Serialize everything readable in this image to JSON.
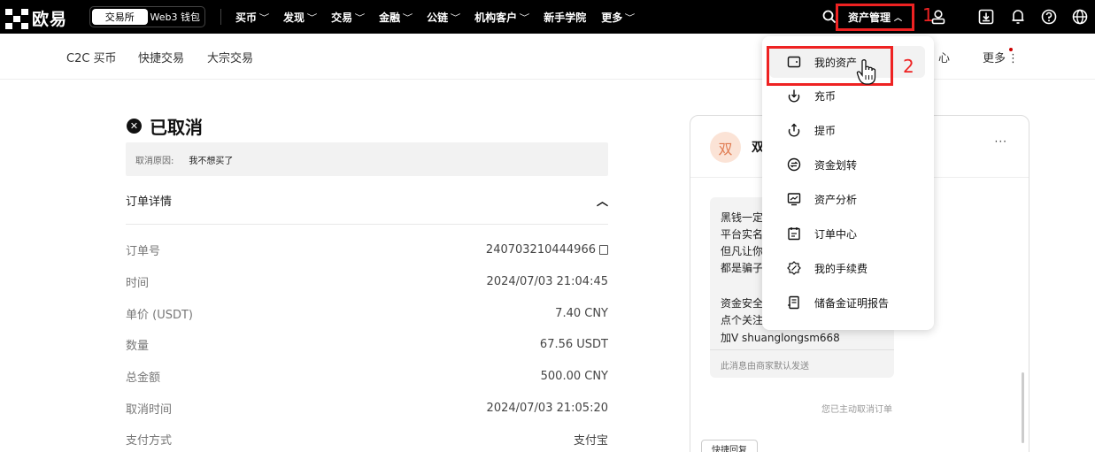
{
  "topnav": {
    "logo_text": "欧易",
    "switch": [
      "交易所",
      "Web3 钱包"
    ],
    "menu": [
      "买币",
      "发现",
      "交易",
      "金融",
      "公链",
      "机构客户",
      "新手学院",
      "更多"
    ],
    "menu_has_chevron": [
      true,
      true,
      true,
      true,
      true,
      true,
      false,
      true
    ],
    "asset_label": "资产管理",
    "annotation_1": "1"
  },
  "subnav": {
    "items": [
      "C2C 买币",
      "快捷交易",
      "大宗交易"
    ],
    "right_fragment": "心",
    "right_prefix": "",
    "more": "更多"
  },
  "order": {
    "status": "已取消",
    "reason_label": "取消原因:",
    "reason_value": "我不想买了",
    "details_title": "订单详情",
    "rows": [
      {
        "k": "订单号",
        "v": "240703210444966"
      },
      {
        "k": "时间",
        "v": "2024/07/03 21:04:45"
      },
      {
        "k": "单价 (USDT)",
        "v": "7.40 CNY"
      },
      {
        "k": "数量",
        "v": "67.56 USDT"
      },
      {
        "k": "总金额",
        "v": "500.00 CNY"
      },
      {
        "k": "取消时间",
        "v": "2024/07/03 21:05:20"
      },
      {
        "k": "支付方式",
        "v": "支付宝"
      }
    ]
  },
  "chat": {
    "avatar": "双",
    "name": "双",
    "more": "···",
    "lines": [
      "黑钱一定",
      "平台实名",
      "但凡让你",
      "都是骗子",
      "",
      "资金安全",
      "点个关注",
      "加V  shuanglongsm668"
    ],
    "footer": "此消息由商家默认发送",
    "system": "您已主动取消订单",
    "quick_reply": "快捷回复"
  },
  "dropdown": {
    "items": [
      {
        "label": "我的资产",
        "icon": "wallet-icon"
      },
      {
        "label": "充币",
        "icon": "deposit-icon"
      },
      {
        "label": "提币",
        "icon": "withdraw-icon"
      },
      {
        "label": "资金划转",
        "icon": "transfer-icon"
      },
      {
        "label": "资产分析",
        "icon": "analysis-icon"
      },
      {
        "label": "订单中心",
        "icon": "orders-icon"
      },
      {
        "label": "我的手续费",
        "icon": "fee-icon"
      },
      {
        "label": "储备金证明报告",
        "icon": "reserve-report-icon"
      }
    ],
    "annotation_2": "2"
  }
}
